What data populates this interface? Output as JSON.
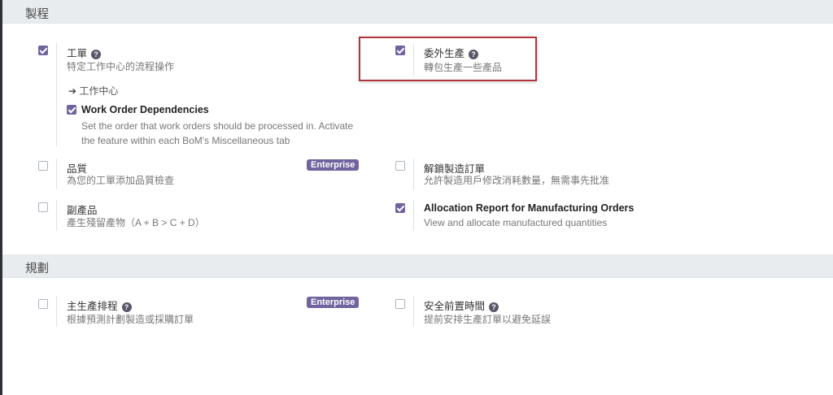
{
  "sections": {
    "manufacturing": {
      "title": "製程"
    },
    "planning": {
      "title": "規劃"
    }
  },
  "settings": {
    "work_orders": {
      "title": "工單",
      "checked": true,
      "description": "特定工作中心的流程操作",
      "link": "工作中心",
      "sub": {
        "title": "Work Order Dependencies",
        "checked": true,
        "description_line1": "Set the order that work orders should be processed in. Activate",
        "description_line2": "the feature within each BoM's Miscellaneous tab"
      }
    },
    "subcontracting": {
      "title": "委外生產",
      "checked": true,
      "description": "轉包生產一些產品"
    },
    "quality": {
      "title": "品質",
      "checked": false,
      "description": "為您的工單添加品質檢查",
      "badge": "Enterprise"
    },
    "unlock_orders": {
      "title": "解鎖製造訂單",
      "checked": false,
      "description": "允許製造用戶修改消耗數量，無需事先批准"
    },
    "byproducts": {
      "title": "副產品",
      "checked": false,
      "description": "產生殘留產物（A + B > C + D）"
    },
    "allocation_report": {
      "title": "Allocation Report for Manufacturing Orders",
      "checked": true,
      "description": "View and allocate manufactured quantities"
    },
    "mps": {
      "title": "主生產排程",
      "checked": false,
      "description": "根據預測計劃製造或採購訂單",
      "badge": "Enterprise"
    },
    "security_lead_time": {
      "title": "安全前置時間",
      "checked": false,
      "description": "提前安排生產訂單以避免延誤"
    }
  },
  "colors": {
    "accent": "#71639e",
    "highlight": "#b0353d",
    "header_bg": "#e9ecef"
  },
  "icons": {
    "help": "question-circle-icon",
    "link_arrow": "arrow-right-icon",
    "checkbox": "checkbox-icon"
  }
}
